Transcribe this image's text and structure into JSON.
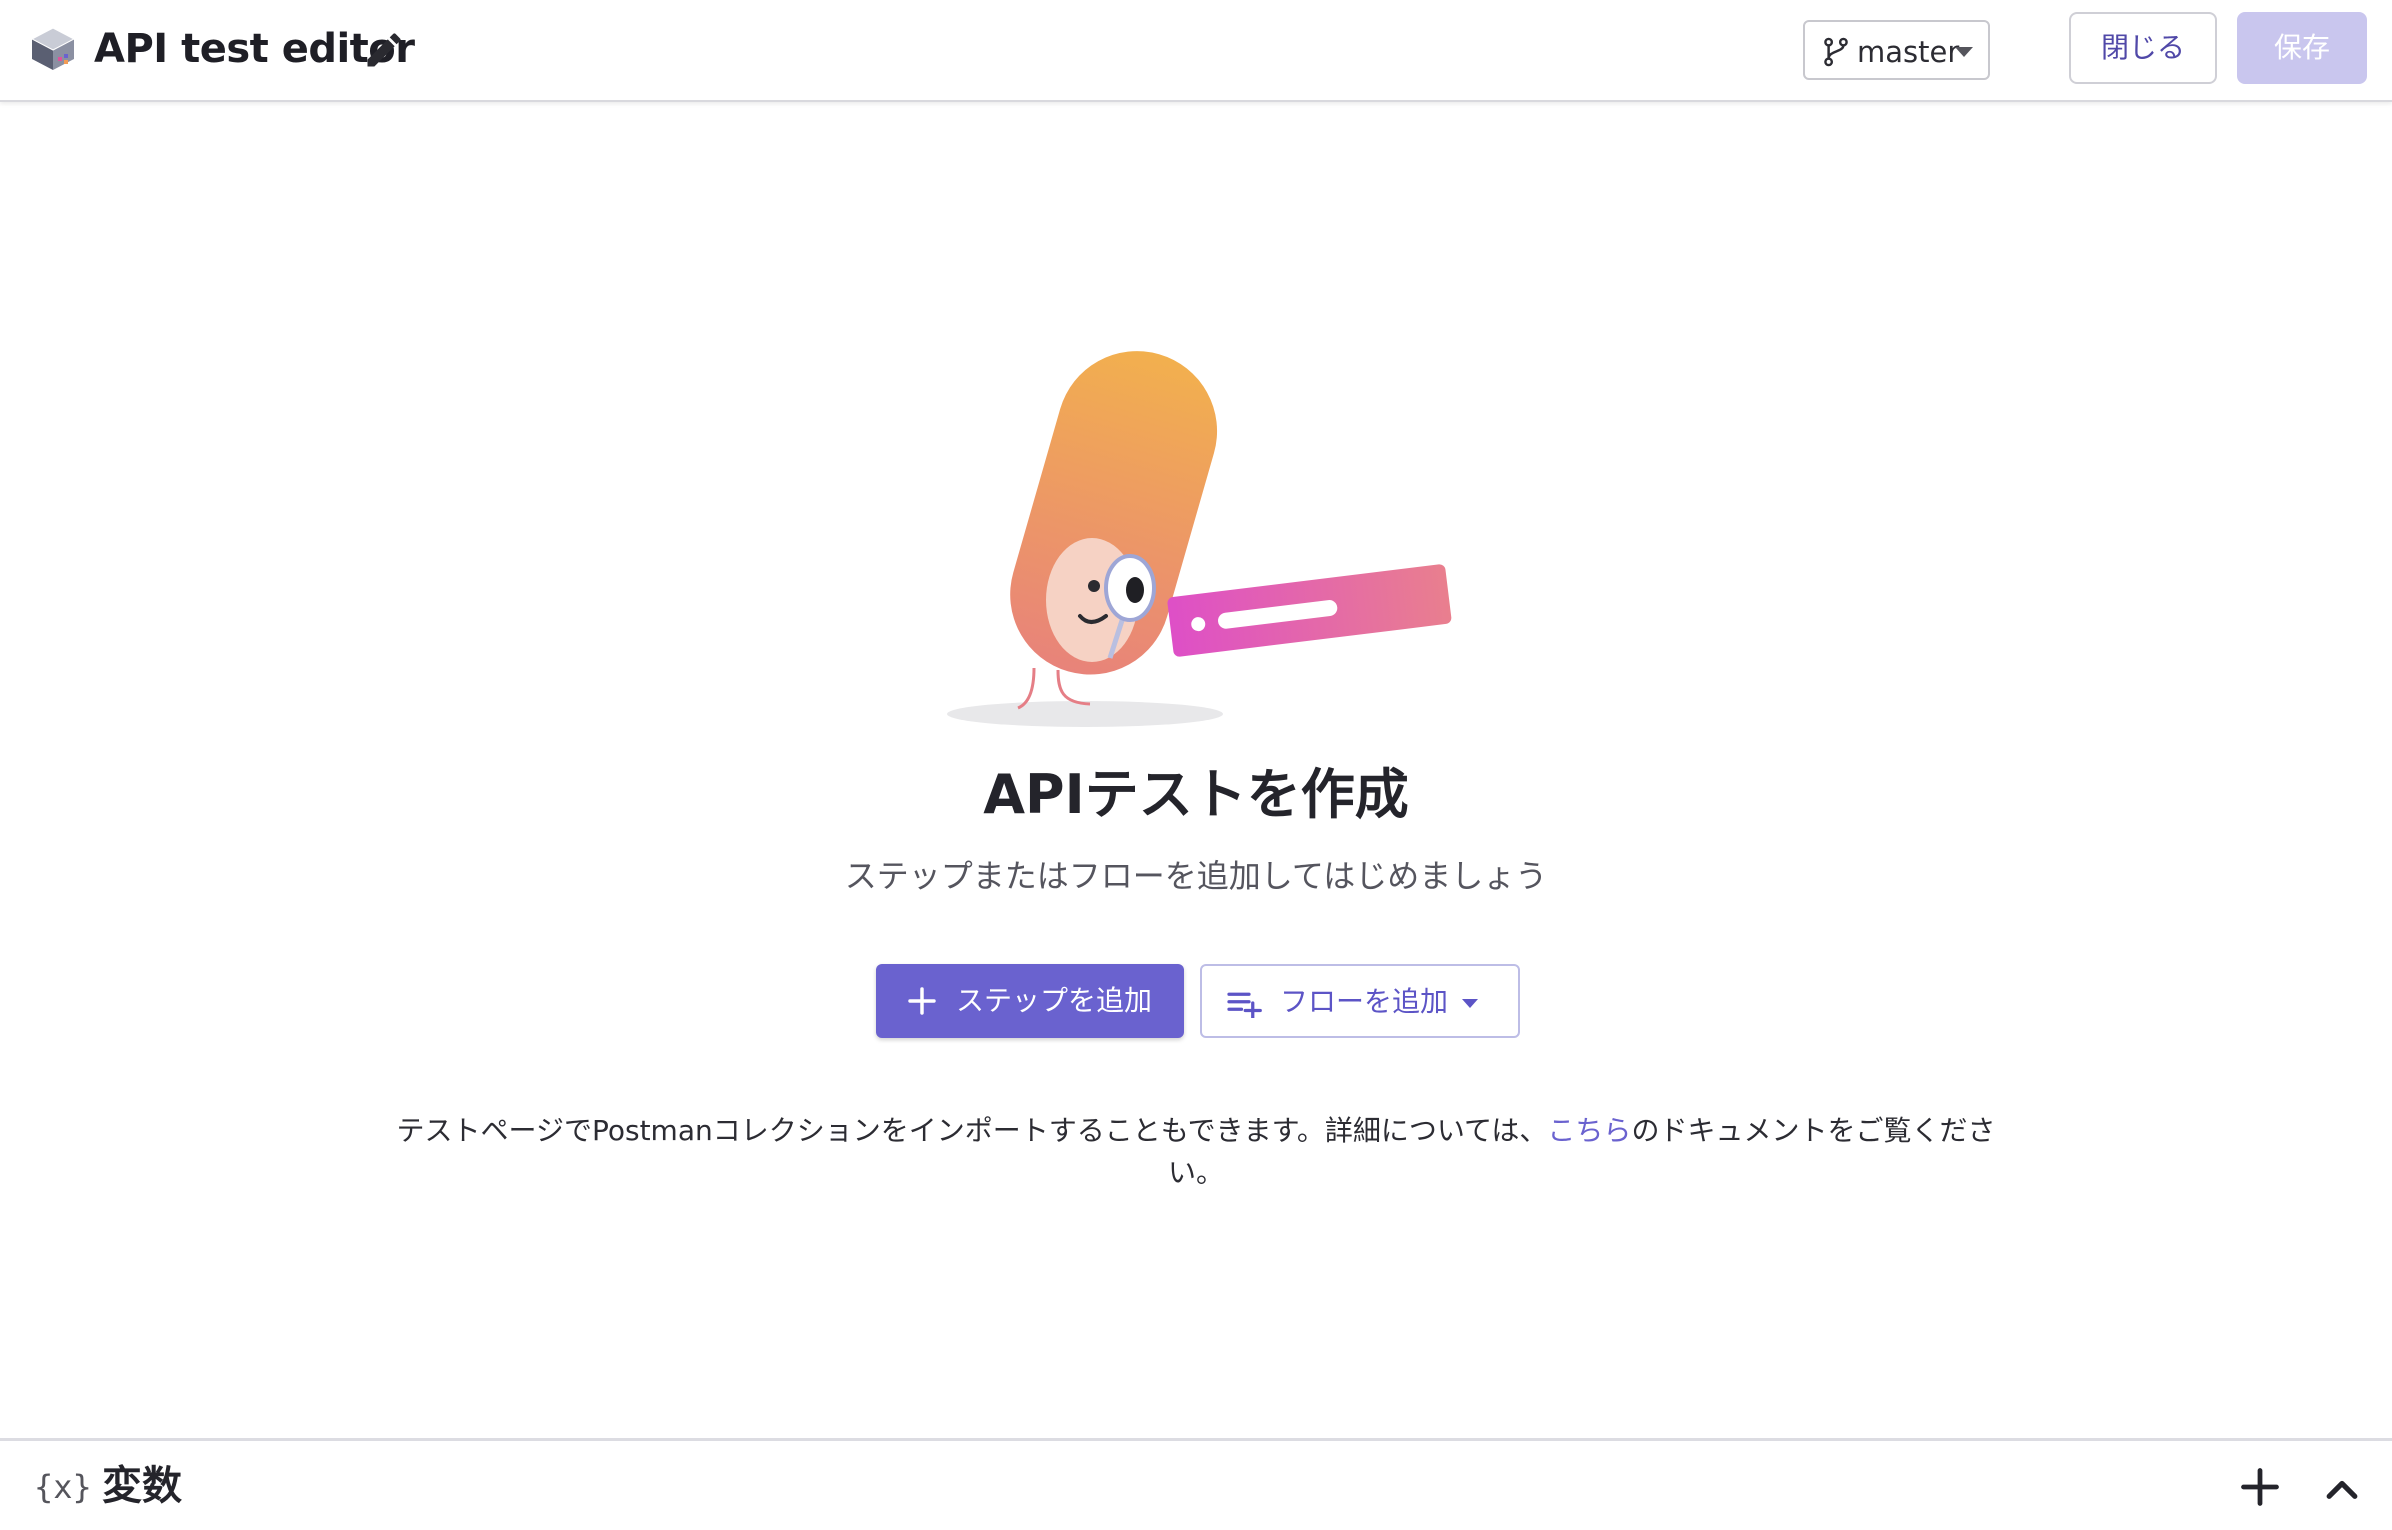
{
  "header": {
    "title": "API test editor",
    "branch": "master",
    "close_label": "閉じる",
    "save_label": "保存"
  },
  "empty_state": {
    "title": "APIテストを作成",
    "subtitle": "ステップまたはフローを追加してはじめましょう",
    "add_step_label": "ステップを追加",
    "add_flow_label": "フローを追加",
    "info_prefix": "テストページでPostmanコレクションをインポートすることもできます。詳細については、",
    "info_link": "こちら",
    "info_suffix": "のドキュメントをご覧ください。"
  },
  "variables_panel": {
    "icon_text": "{x}",
    "title": "変数"
  },
  "icons": {
    "logo": "stacked-layers-logo",
    "edit": "pencil-icon",
    "branch": "git-branch-icon",
    "add_step": "plus-icon",
    "add_flow": "playlist-add-icon",
    "add_variable": "plus-icon",
    "collapse": "chevron-up-icon"
  },
  "colors": {
    "accent": "#6a62cf",
    "save_disabled": "#c9c6ee",
    "link": "#6a62cf"
  }
}
